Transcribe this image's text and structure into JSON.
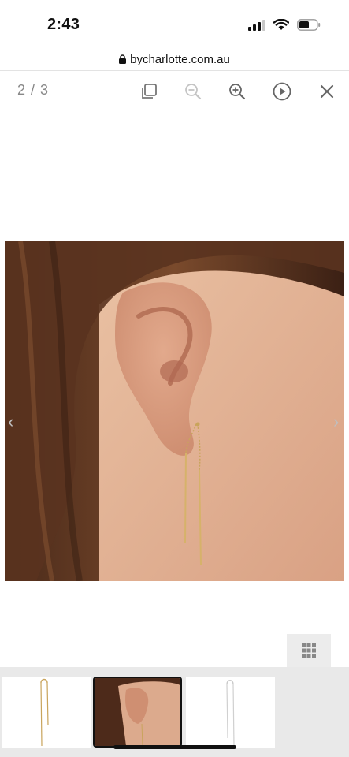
{
  "status_bar": {
    "time": "2:43"
  },
  "browser": {
    "url": "bycharlotte.com.au"
  },
  "viewer": {
    "counter": "2 / 3",
    "icons": [
      "copy-icon",
      "zoom-out-icon",
      "zoom-in-icon",
      "play-icon",
      "close-icon"
    ],
    "prev_arrow": "‹",
    "next_arrow": "›"
  },
  "colors": {
    "accent_gold": "#c9a45c",
    "hair": "#3a2116",
    "skin": "#e3b497"
  }
}
